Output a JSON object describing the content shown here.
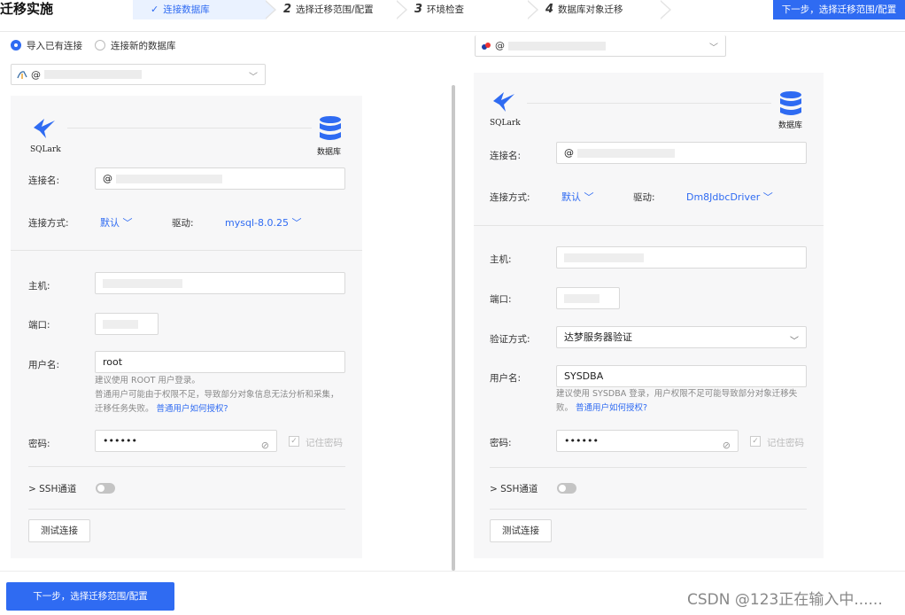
{
  "header": {
    "title": "迁移实施",
    "steps": [
      {
        "num": "✓",
        "label": "连接数据库"
      },
      {
        "num": "2",
        "label": "选择迁移范围/配置"
      },
      {
        "num": "3",
        "label": "环境检查"
      },
      {
        "num": "4",
        "label": "数据库对象迁移"
      }
    ],
    "next_label": "下一步，选择迁移范围/配置"
  },
  "source": {
    "radio_existing": "导入已有连接",
    "radio_new": "连接新的数据库",
    "selected_connection": "@",
    "logo_label": "SQLark",
    "db_label": "数据库",
    "conn_name_label": "连接名:",
    "conn_name_value": "@",
    "conn_method_label": "连接方式:",
    "conn_method_value": "默认",
    "driver_label": "驱动:",
    "driver_value": "mysql-8.0.25",
    "host_label": "主机:",
    "port_label": "端口:",
    "user_label": "用户名:",
    "user_value": "root",
    "user_hint_1": "建议使用 ROOT 用户登录。",
    "user_hint_2": "普通用户可能由于权限不足，导致部分对象信息无法分析和采集，",
    "user_hint_3": "迁移任务失败。",
    "user_hint_link": "普通用户如何授权?",
    "password_label": "密码:",
    "password_value": "••••••",
    "remember_label": "记住密码",
    "ssh_label": "SSH通道",
    "test_button": "测试连接"
  },
  "target": {
    "selected_connection": "@",
    "logo_label": "SQLark",
    "db_label": "数据库",
    "conn_name_label": "连接名:",
    "conn_name_value": "@",
    "conn_method_label": "连接方式:",
    "conn_method_value": "默认",
    "driver_label": "驱动:",
    "driver_value": "Dm8JdbcDriver",
    "host_label": "主机:",
    "port_label": "端口:",
    "auth_label": "验证方式:",
    "auth_value": "达梦服务器验证",
    "user_label": "用户名:",
    "user_value": "SYSDBA",
    "user_hint_1": "建议使用 SYSDBA 登录，用户权限不足可能导致部分对象迁移失",
    "user_hint_2": "败。",
    "user_hint_link": "普通用户如何授权?",
    "password_label": "密码:",
    "password_value": "••••••",
    "remember_label": "记住密码",
    "ssh_label": "SSH通道",
    "test_button": "测试连接"
  },
  "footer": {
    "next_label": "下一步，选择迁移范围/配置",
    "watermark": "CSDN @123正在输入中......"
  },
  "colors": {
    "accent": "#2f6bf2",
    "card_bg": "#f7f7f8"
  }
}
